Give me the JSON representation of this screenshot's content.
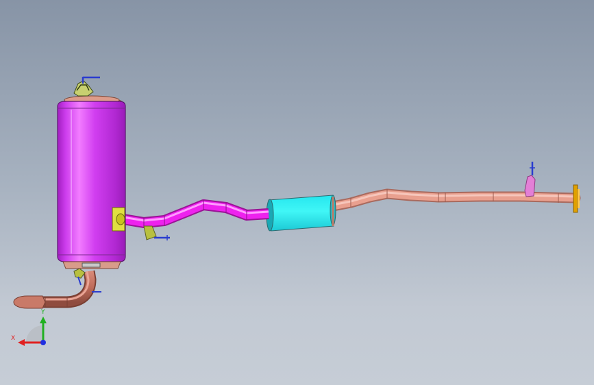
{
  "view": {
    "background_top": "#8794a6",
    "background_bottom": "#c6cdd6"
  },
  "parts": {
    "rear_muffler": {
      "body_color": "#cc33ee",
      "end_cap_color": "#d28f7a"
    },
    "mid_muffler": {
      "body_color": "#2ee6e6"
    },
    "connecting_pipe": {
      "color": "#ee22ee"
    },
    "front_pipe": {
      "color": "#e8988a"
    },
    "tailpipe": {
      "color": "#c0705e"
    },
    "inlet_flange": {
      "color": "#e0a000"
    },
    "hanger_bracket": {
      "color": "#c9c900"
    },
    "hanger_rod": {
      "color": "#2a3ccf"
    }
  },
  "triad": {
    "x_label": "X",
    "y_label": "Y",
    "x_color": "#e02020",
    "y_color": "#20b020",
    "z_color": "#2030e0",
    "icon": "coordinate-triad-icon"
  }
}
